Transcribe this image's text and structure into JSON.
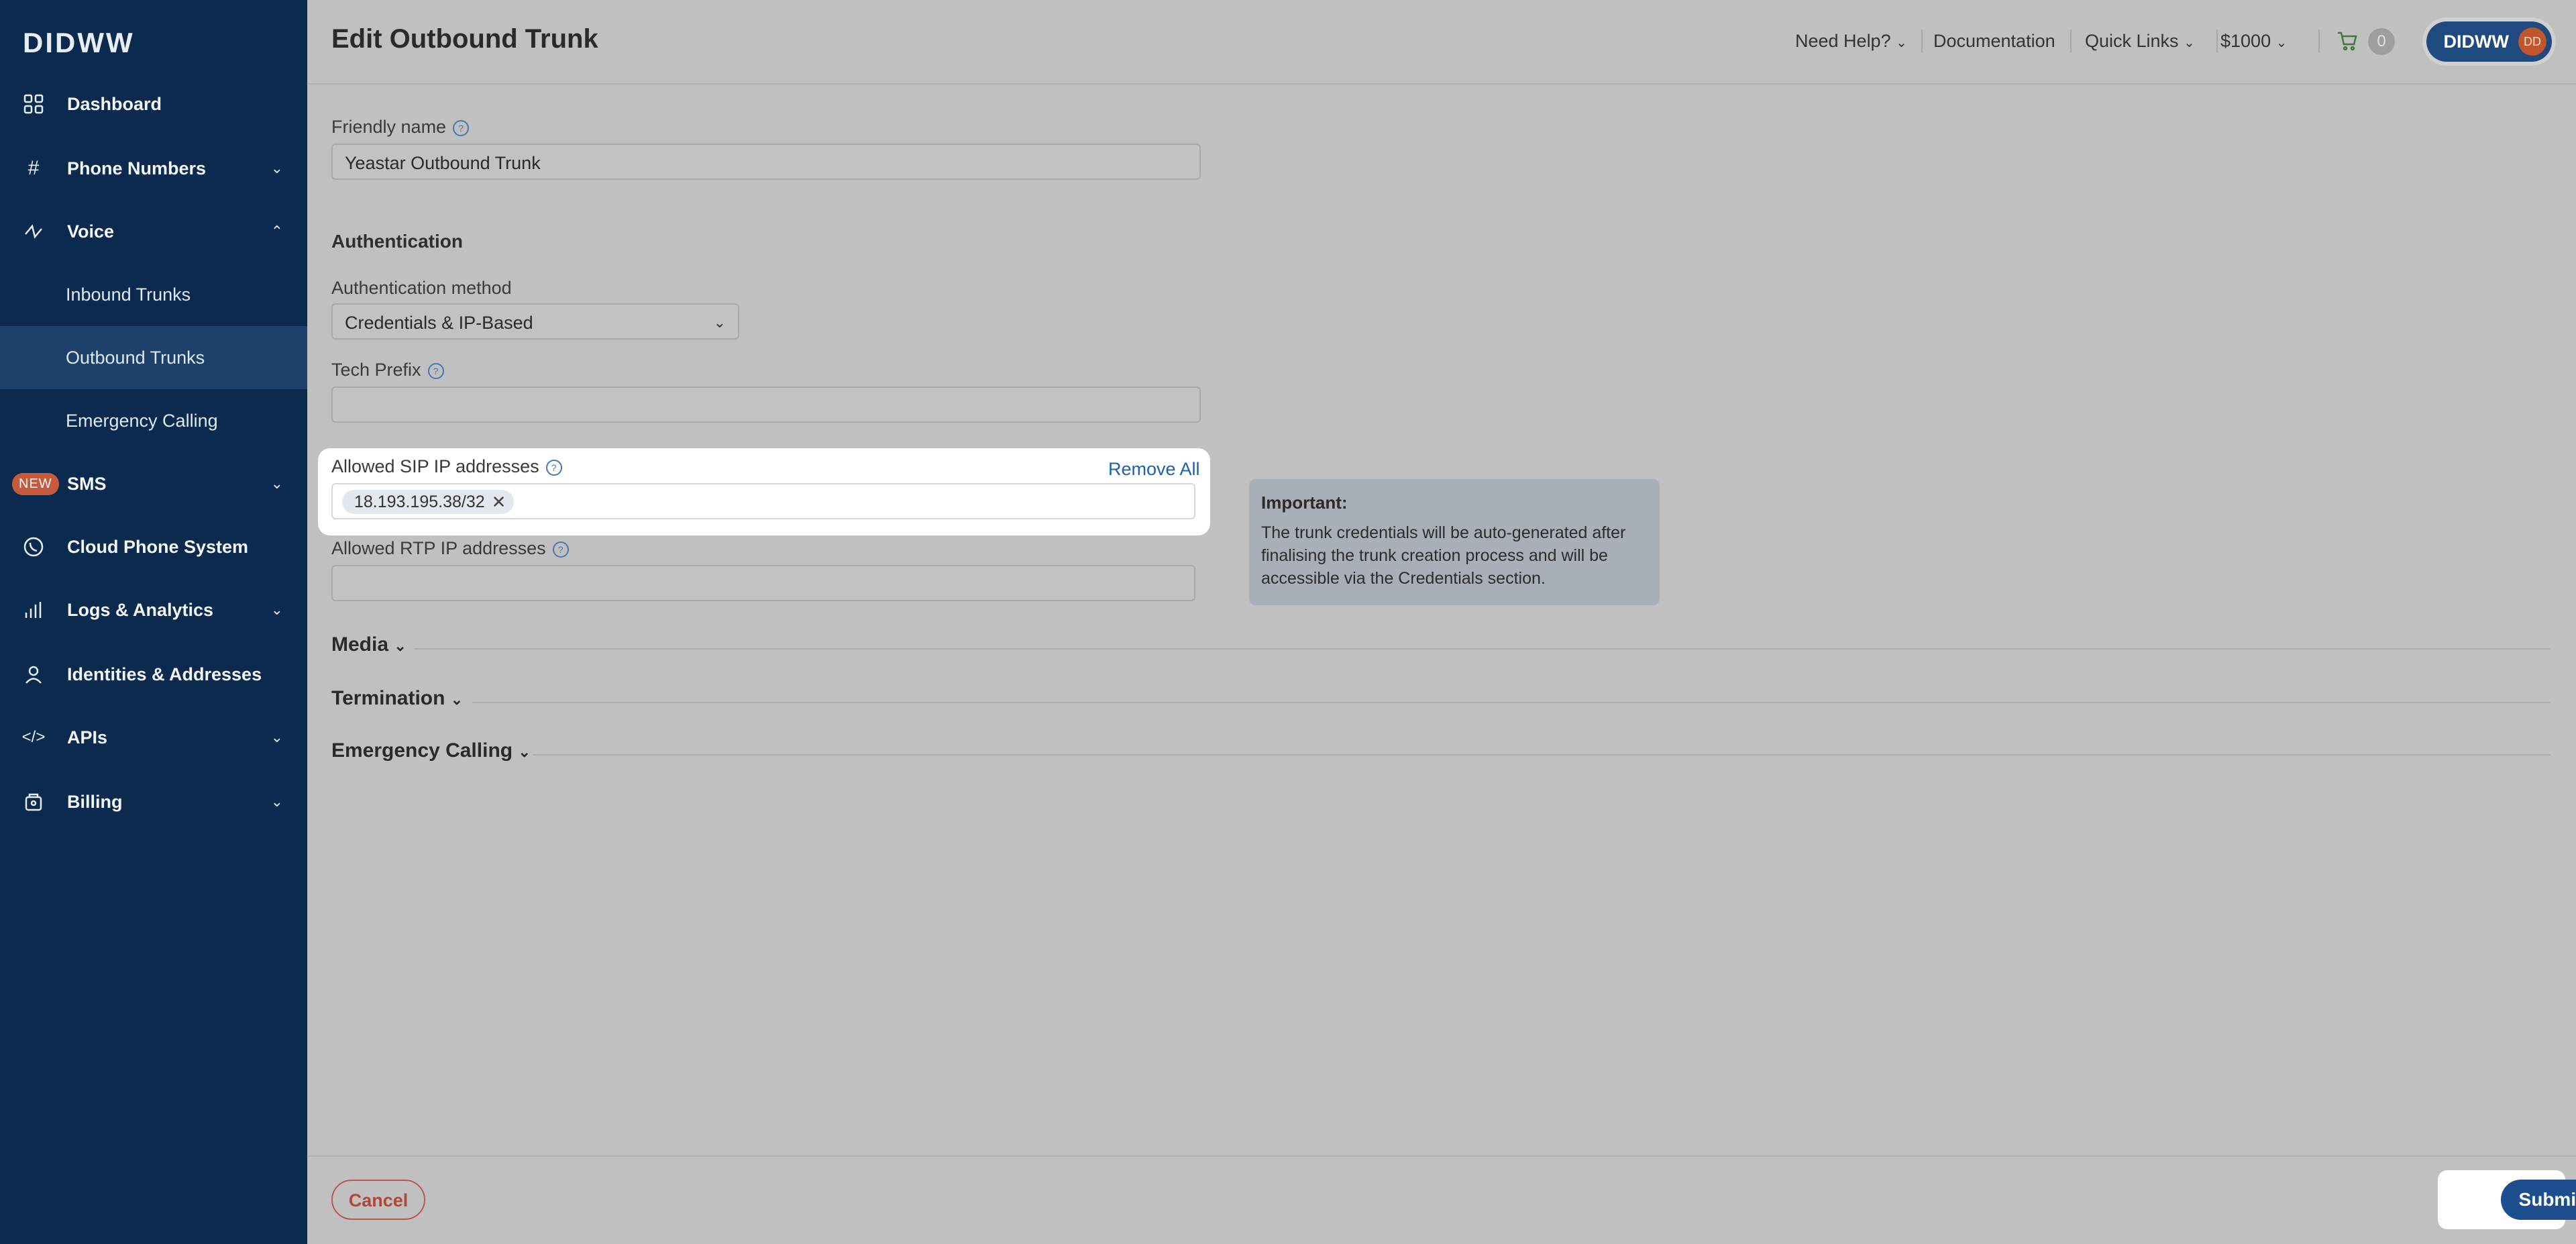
{
  "app": {
    "logo": "DIDWW"
  },
  "sidebar": {
    "items": [
      {
        "label": "Dashboard"
      },
      {
        "label": "Phone Numbers"
      },
      {
        "label": "Voice"
      },
      {
        "label": "Inbound Trunks"
      },
      {
        "label": "Outbound Trunks"
      },
      {
        "label": "Emergency Calling"
      },
      {
        "label": "SMS",
        "badge": "NEW"
      },
      {
        "label": "Cloud Phone System"
      },
      {
        "label": "Logs & Analytics"
      },
      {
        "label": "Identities & Addresses"
      },
      {
        "label": "APIs"
      },
      {
        "label": "Billing"
      }
    ]
  },
  "header": {
    "title": "Edit Outbound Trunk",
    "need_help": "Need Help?",
    "documentation": "Documentation",
    "quick_links": "Quick Links",
    "balance": "$1000",
    "cart_count": "0",
    "user_name": "DIDWW",
    "user_initials": "DD"
  },
  "form": {
    "friendly_name_label": "Friendly name",
    "friendly_name_value": "Yeastar Outbound Trunk",
    "authentication_title": "Authentication",
    "auth_method_label": "Authentication method",
    "auth_method_value": "Credentials & IP-Based",
    "tech_prefix_label": "Tech Prefix",
    "tech_prefix_value": "",
    "sip_label": "Allowed SIP IP addresses",
    "remove_all": "Remove All",
    "sip_tags": [
      "18.193.195.38/32"
    ],
    "rtp_label": "Allowed RTP IP addresses",
    "rtp_value": ""
  },
  "info": {
    "title": "Important:",
    "body": "The trunk credentials will be auto-generated after finalising the trunk creation process and will be accessible via the Credentials section."
  },
  "sections": [
    {
      "title": "Media"
    },
    {
      "title": "Termination"
    },
    {
      "title": "Emergency Calling"
    }
  ],
  "footer": {
    "cancel": "Cancel",
    "submit": "Submit"
  }
}
